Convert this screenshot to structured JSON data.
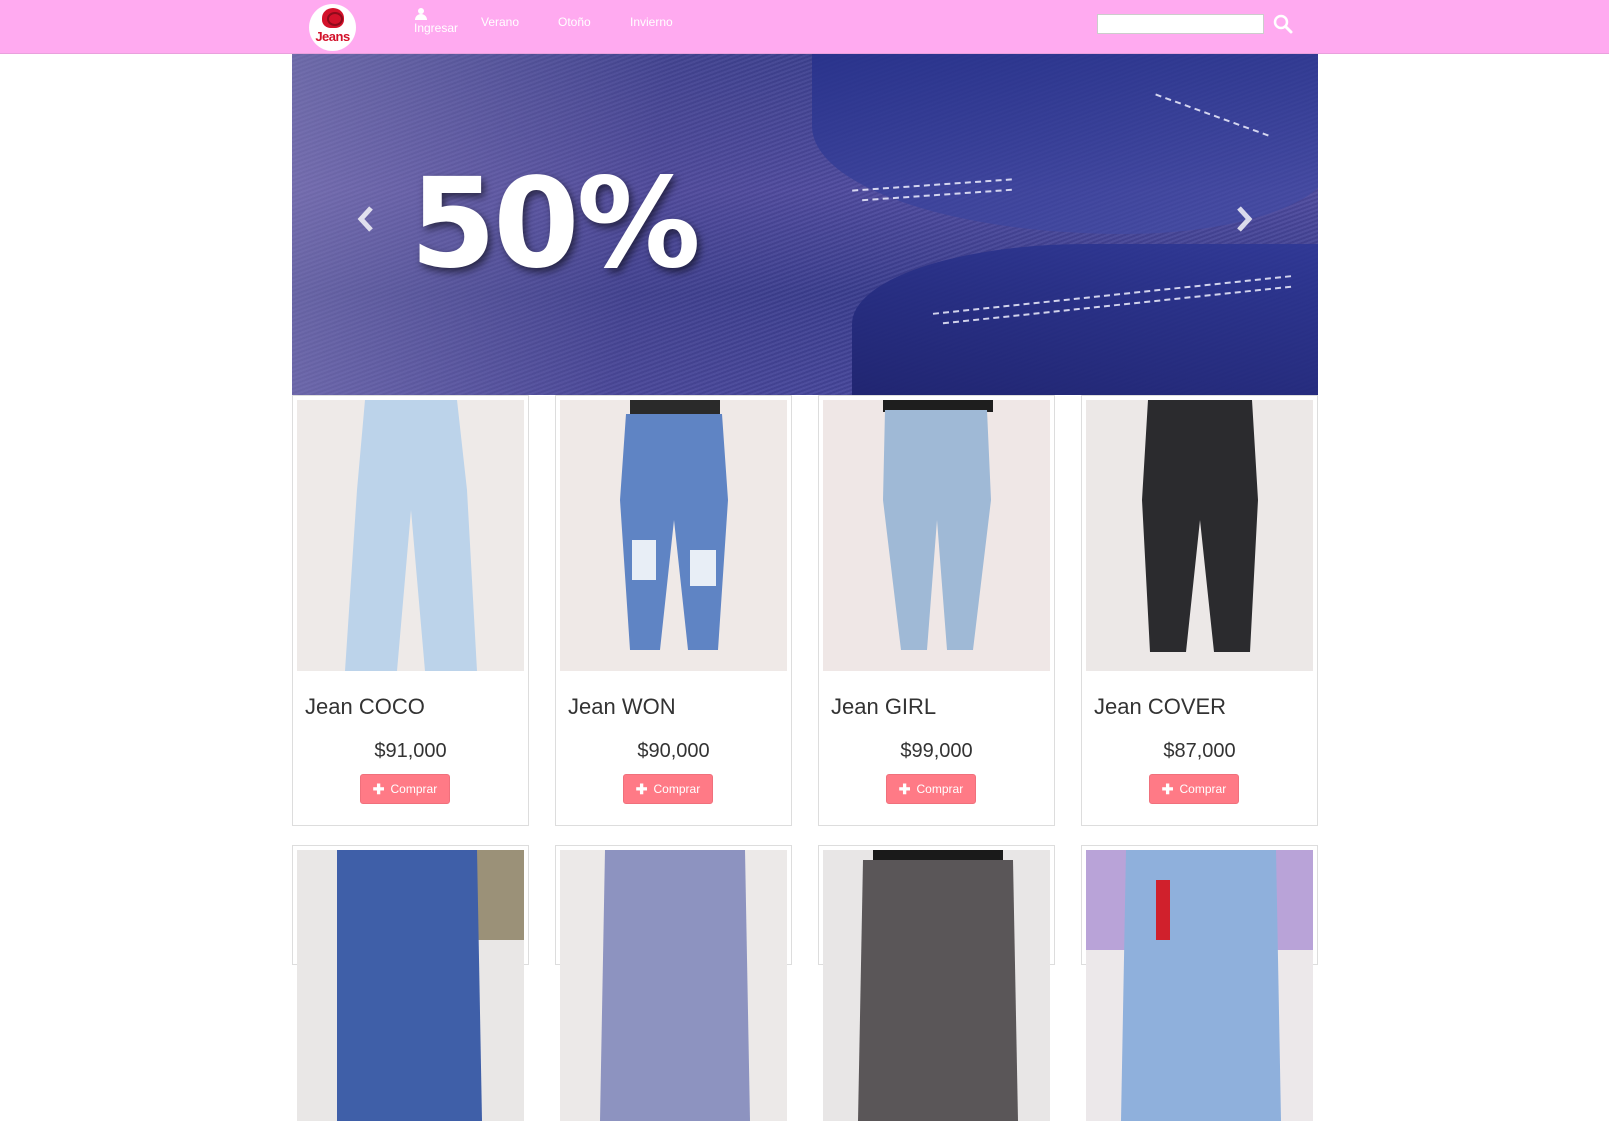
{
  "nav": {
    "logo_text": "Jeans",
    "ingresar": "Ingresar",
    "verano": "Verano",
    "otono": "Otoño",
    "invierno": "Invierno",
    "search_placeholder": ""
  },
  "carousel": {
    "promo": "50%"
  },
  "products": [
    {
      "name": "Jean COCO",
      "price": "$91,000",
      "button": "Comprar",
      "color": "#bcd3ea"
    },
    {
      "name": "Jean WON",
      "price": "$90,000",
      "button": "Comprar",
      "color": "#5f84c4"
    },
    {
      "name": "Jean GIRL",
      "price": "$99,000",
      "button": "Comprar",
      "color": "#9fb9d6"
    },
    {
      "name": "Jean COVER",
      "price": "$87,000",
      "button": "Comprar",
      "color": "#2b2b2e"
    }
  ],
  "products_row2": [
    {
      "color": "#3f5fa8"
    },
    {
      "color": "#8d93c0"
    },
    {
      "color": "#5a5658"
    },
    {
      "color": "#8fb0dc"
    }
  ],
  "colors": {
    "navbar": "#ffaaf0",
    "button": "#ff7a86"
  }
}
